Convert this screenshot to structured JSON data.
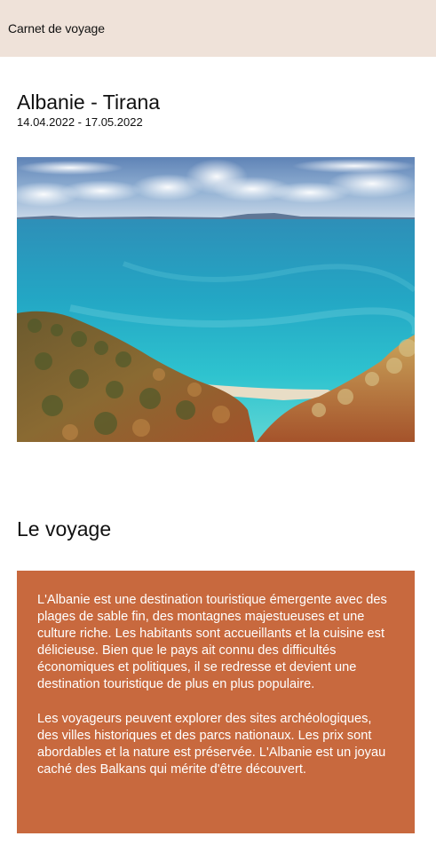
{
  "appbar": {
    "title": "Carnet de voyage"
  },
  "trip": {
    "title": "Albanie - Tirana",
    "dates": "14.04.2022 - 17.05.2022"
  },
  "section": {
    "title": "Le voyage"
  },
  "description": {
    "paragraphs": [
      "L'Albanie est une destination touristique émergente avec des plages de sable fin, des montagnes majestueuses et une culture riche. Les habitants sont accueillants et la cuisine est délicieuse. Bien que le pays ait connu des difficultés économiques et politiques, il se redresse et devient une destination touristique de plus en plus populaire.",
      "Les voyageurs peuvent explorer des sites archéologiques, des villes historiques et des parcs nationaux. Les prix sont abordables et la nature est préservée. L'Albanie est un joyau caché des Balkans qui mérite d'être découvert."
    ]
  },
  "colors": {
    "appbar": "#efe2d9",
    "card": "#c8693e"
  }
}
